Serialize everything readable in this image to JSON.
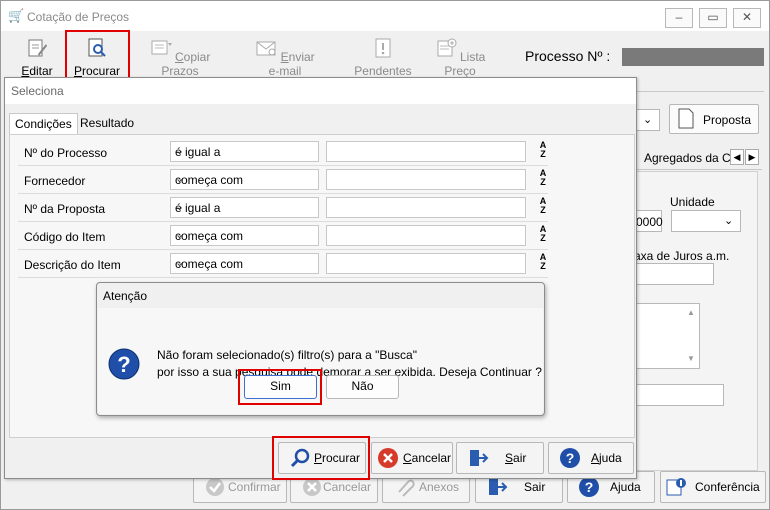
{
  "window": {
    "title": "Cotação de Preços",
    "minimize": "–",
    "maximize": "▭",
    "close": "✕"
  },
  "toolbar": {
    "editar": {
      "pre": "",
      "u": "E",
      "post": "ditar"
    },
    "procurar": {
      "pre": "",
      "u": "P",
      "post": "rocurar"
    },
    "copiar": {
      "pre": "",
      "u": "C",
      "post": "opiar Prazos"
    },
    "enviar": {
      "pre": "",
      "u": "E",
      "post": "nviar e-mail"
    },
    "pendentes": {
      "pre": "",
      "u": "",
      "post": "Pendentes"
    },
    "lista": {
      "pre": "",
      "u": "",
      "post": "Lista Preço"
    }
  },
  "processo_label": "Processo Nº :",
  "background": {
    "proposta": "Proposta",
    "agregados": "Agregados da C",
    "unidade": "Unidade",
    "value_0000": "0000",
    "taxa": "axa de Juros a.m.",
    "confirmar": "Confirmar",
    "cancelar": "Cancelar",
    "anexos": "Anexos",
    "sair": "Sair",
    "ajuda": "Ajuda",
    "conferencia": "Conferência"
  },
  "seleciona": {
    "title": "Seleciona",
    "tabs": [
      "Condições",
      "Resultado"
    ],
    "rows": [
      {
        "label": "Nº do Processo",
        "operator": "é igual a",
        "value": ""
      },
      {
        "label": "Fornecedor",
        "operator": "começa com",
        "value": ""
      },
      {
        "label": "Nº da Proposta",
        "operator": "é igual a",
        "value": ""
      },
      {
        "label": "Código do Item",
        "operator": "começa com",
        "value": ""
      },
      {
        "label": "Descrição do Item",
        "operator": "começa com",
        "value": ""
      }
    ],
    "buttons": {
      "procurar": "rocurar",
      "procurar_u": "P",
      "cancelar": "ancelar",
      "cancelar_u": "C",
      "sair": "air",
      "sair_u": "S",
      "ajuda": "juda",
      "ajuda_u": "A"
    }
  },
  "atencao": {
    "title": "Atenção",
    "line1": "Não foram selecionado(s) filtro(s) para a \"Busca\"",
    "line2": "por isso a sua pesquisa pode demorar a ser exibida. Deseja Continuar ?",
    "sim": "Sim",
    "nao": "Não"
  },
  "colors": {
    "highlight": "#e00000",
    "question": "#1f4fa8",
    "cancel": "#d63a2a"
  }
}
